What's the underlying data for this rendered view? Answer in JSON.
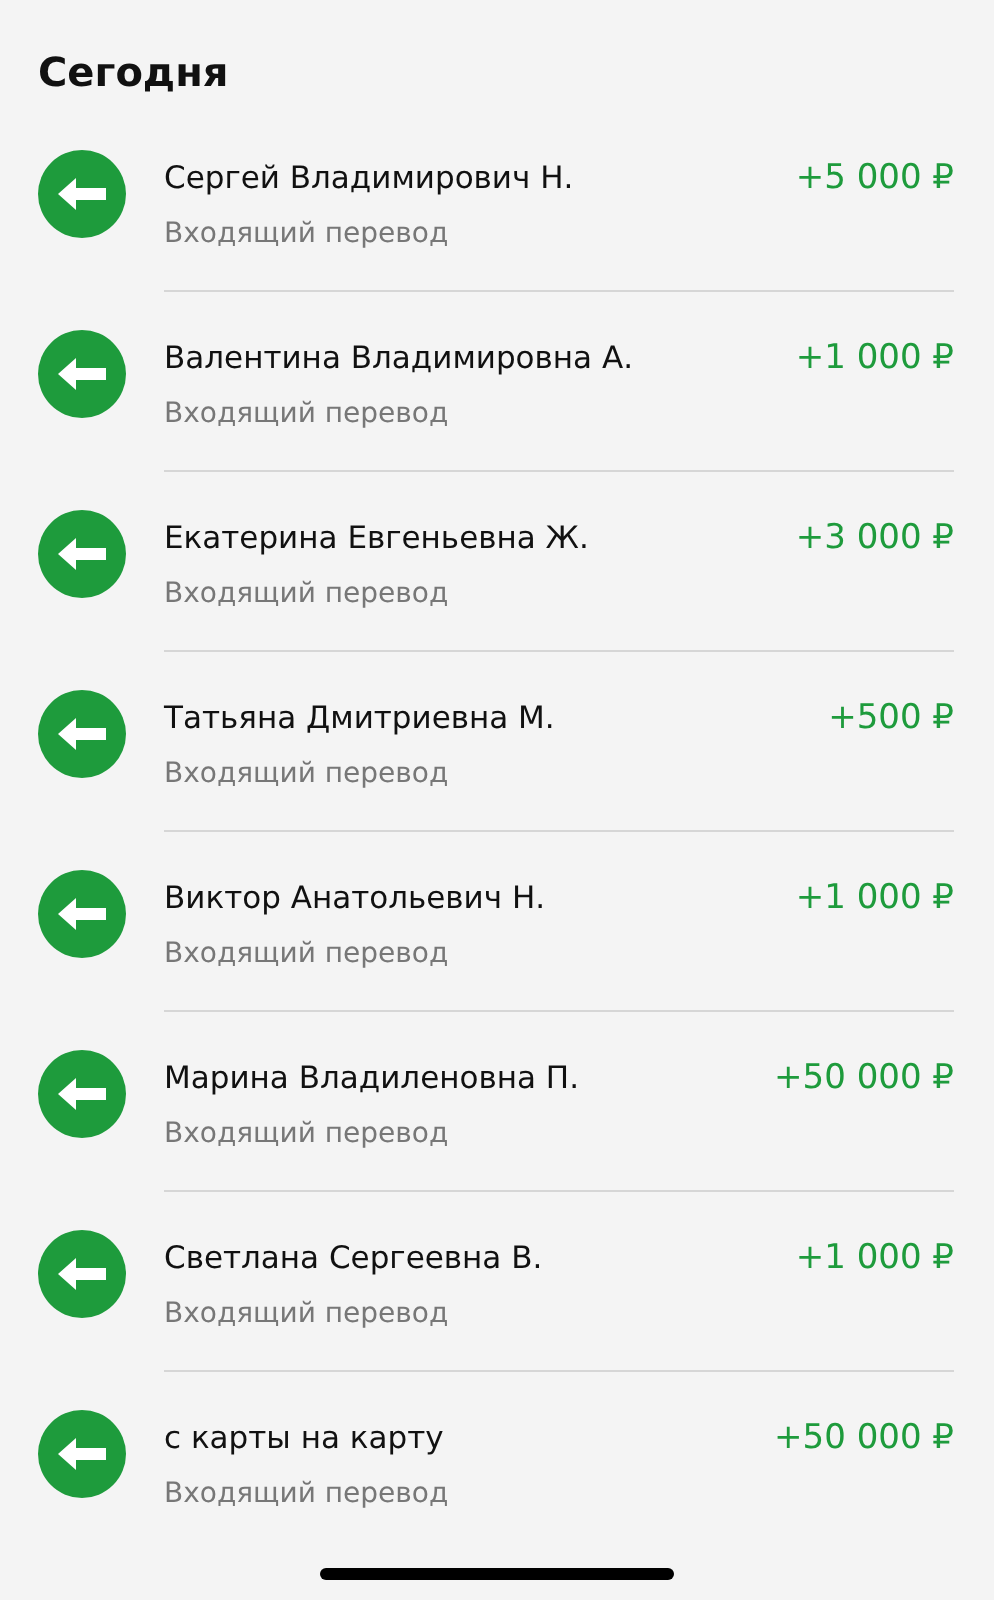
{
  "section_title": "Сегодня",
  "transactions": [
    {
      "name": "Сергей Владимирович Н.",
      "type": "Входящий перевод",
      "amount": "+5 000 ₽",
      "kind": "incoming"
    },
    {
      "name": "Валентина Владимировна А.",
      "type": "Входящий перевод",
      "amount": "+1 000 ₽",
      "kind": "incoming"
    },
    {
      "name": "Екатерина Евгеньевна Ж.",
      "type": "Входящий перевод",
      "amount": "+3 000 ₽",
      "kind": "incoming"
    },
    {
      "name": "Татьяна Дмитриевна М.",
      "type": "Входящий перевод",
      "amount": "+500 ₽",
      "kind": "incoming"
    },
    {
      "name": "Виктор Анатольевич Н.",
      "type": "Входящий перевод",
      "amount": "+1 000 ₽",
      "kind": "incoming"
    },
    {
      "name": "Марина Владиленовна П.",
      "type": "Входящий перевод",
      "amount": "+50 000 ₽",
      "kind": "incoming"
    },
    {
      "name": "Светлана Сергеевна В.",
      "type": "Входящий перевод",
      "amount": "+1 000 ₽",
      "kind": "incoming"
    },
    {
      "name": "с карты на карту",
      "type": "Входящий перевод",
      "amount": "+50 000 ₽",
      "kind": "incoming"
    }
  ]
}
